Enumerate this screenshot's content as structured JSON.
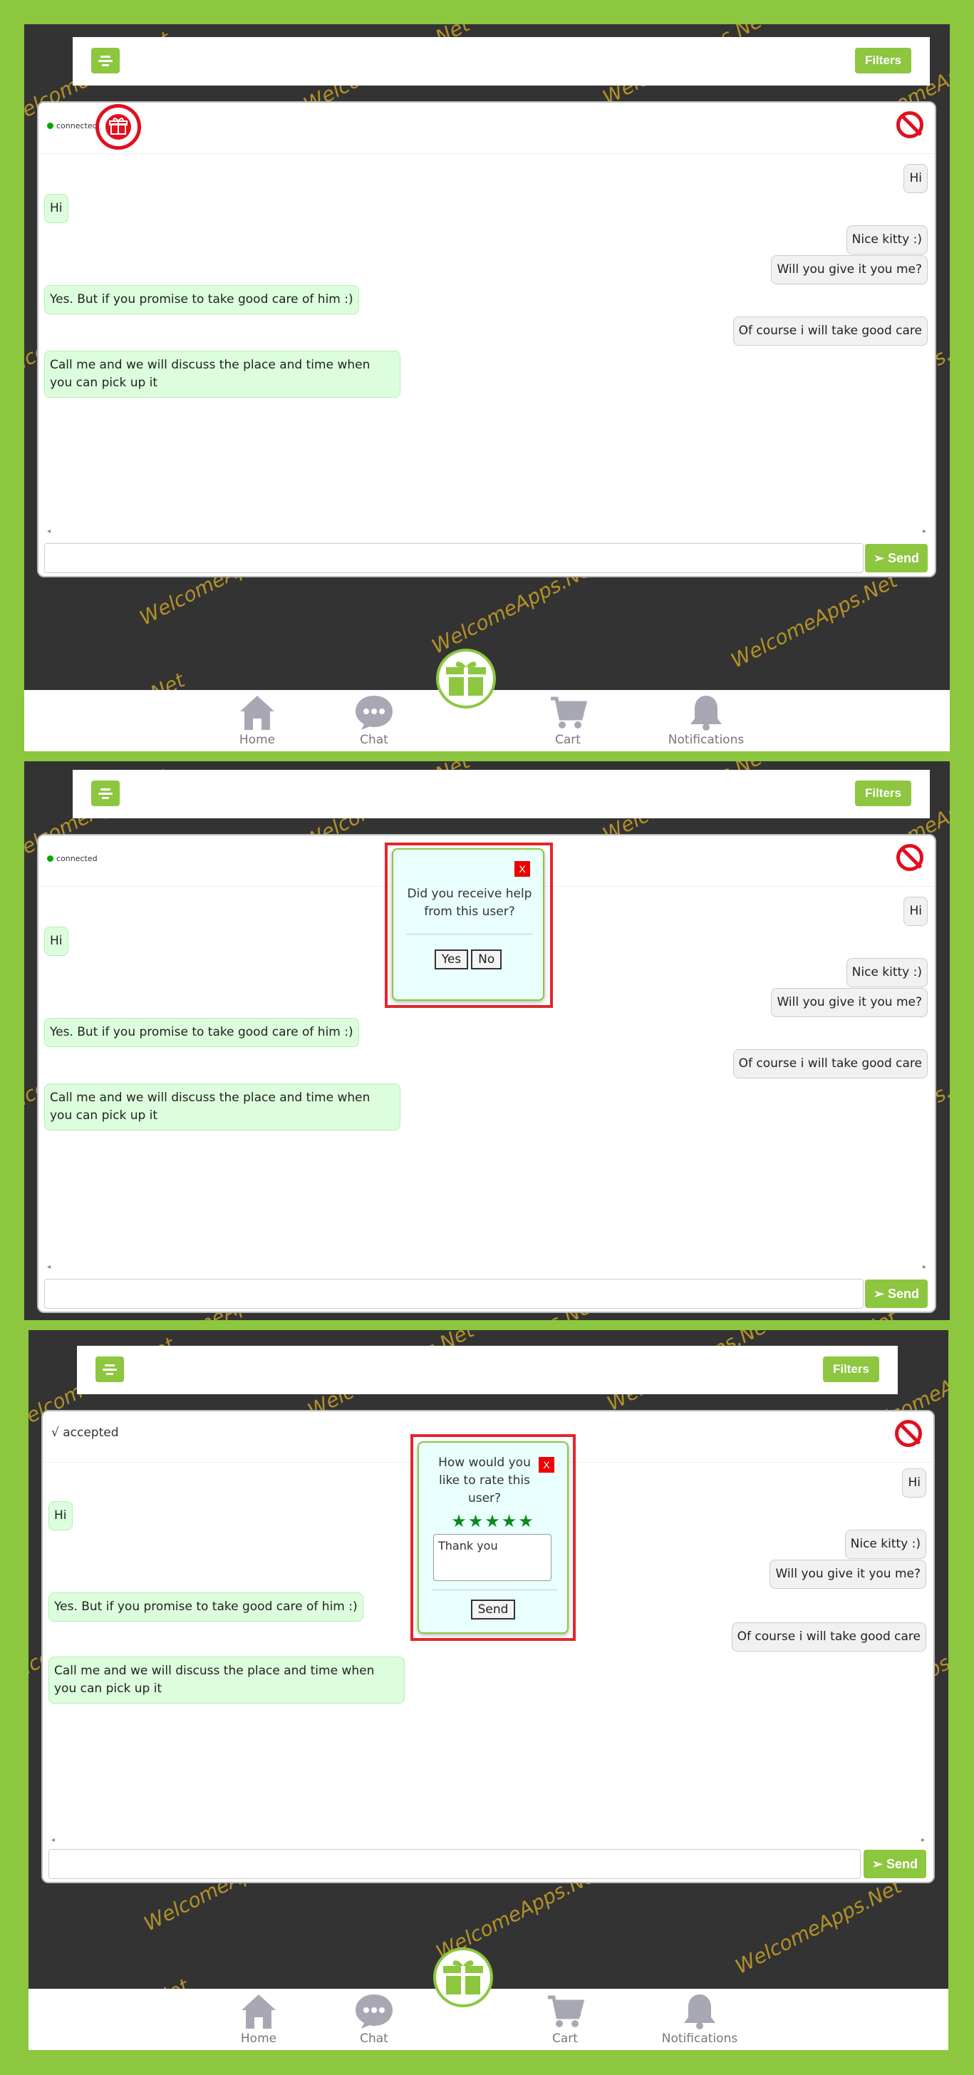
{
  "watermark": "WelcomeApps.Net",
  "topbar": {
    "filters_label": "Filters",
    "menu_icon": "menu-icon"
  },
  "chat": {
    "status_connected": "connected",
    "status_accepted": "√ accepted",
    "messages": [
      {
        "dir": "out",
        "text": "Hi"
      },
      {
        "dir": "in",
        "text": "Hi"
      },
      {
        "dir": "out",
        "text": "Nice kitty :)"
      },
      {
        "dir": "out",
        "text": "Will you give it you me?"
      },
      {
        "dir": "in",
        "text": "Yes. But if you promise to take good care of him :)"
      },
      {
        "dir": "out",
        "text": "Of course i will take good care"
      },
      {
        "dir": "in",
        "text": "Call me and we will discuss the place and time when you can pick up it"
      }
    ],
    "input_value": "",
    "send_label": "Send"
  },
  "popup_help": {
    "question": "Did you receive help from this user?",
    "yes": "Yes",
    "no": "No",
    "close": "X"
  },
  "popup_rate": {
    "question": "How would you like to rate this user?",
    "rating": 5,
    "stars": "★★★★★",
    "feedback": "Thank you",
    "send": "Send",
    "close": "X"
  },
  "nav": {
    "home": "Home",
    "chat": "Chat",
    "cart": "Cart",
    "notifications": "Notifications"
  },
  "colors": {
    "accent": "#8dc63f",
    "dark": "#333333",
    "ban": "#e0101f",
    "frame_red": "#e3262e",
    "in_bubble": "#dcfedc",
    "out_bubble": "#f1f1f1"
  }
}
